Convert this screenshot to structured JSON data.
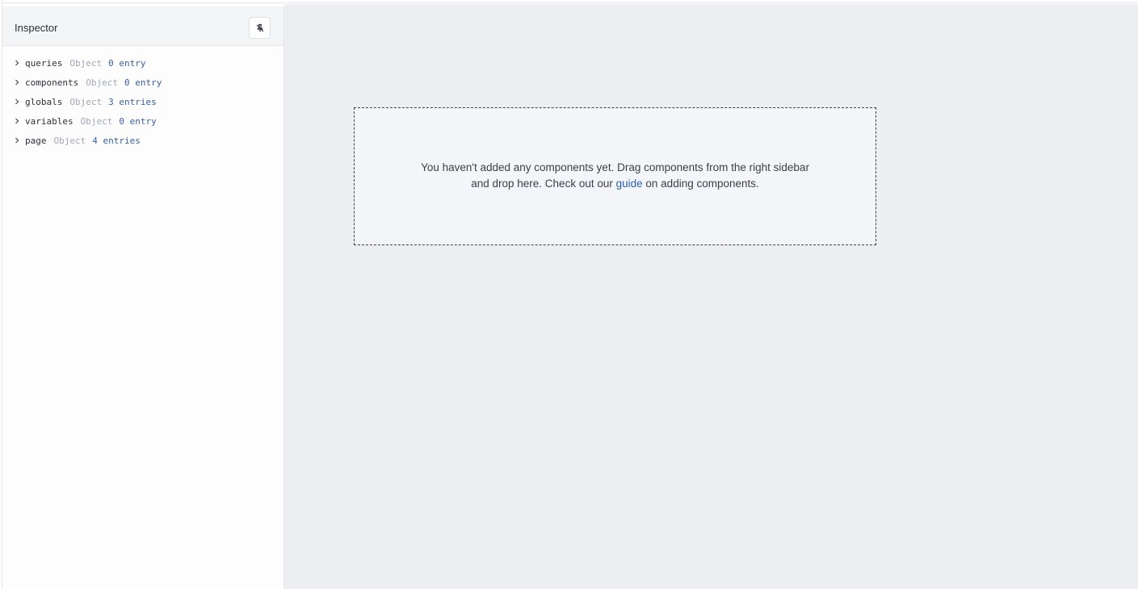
{
  "inspector": {
    "title": "Inspector",
    "pin_icon": "pin-off-icon",
    "items": [
      {
        "key": "queries",
        "type": "Object",
        "count": "0 entry"
      },
      {
        "key": "components",
        "type": "Object",
        "count": "0 entry"
      },
      {
        "key": "globals",
        "type": "Object",
        "count": "3 entries"
      },
      {
        "key": "variables",
        "type": "Object",
        "count": "0 entry"
      },
      {
        "key": "page",
        "type": "Object",
        "count": "4 entries"
      }
    ]
  },
  "canvas": {
    "empty_text_1": "You haven't added any components yet. Drag components from the right sidebar",
    "empty_text_2": "and drop here. Check out our ",
    "guide_link": "guide",
    "empty_text_3": " on adding components."
  },
  "colors": {
    "link": "#2d63b7",
    "canvas_bg": "#eceef2",
    "count": "#3a5f9e",
    "type": "#a0a7b4"
  }
}
